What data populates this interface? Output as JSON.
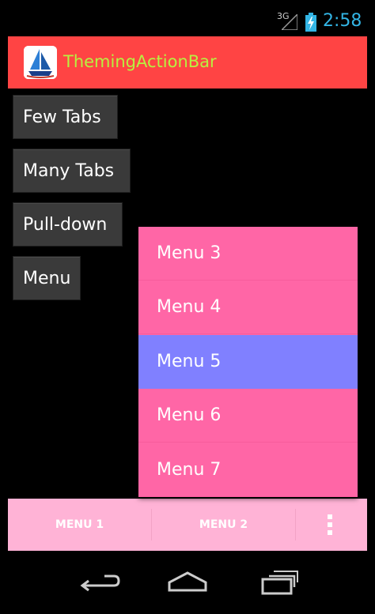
{
  "status_bar": {
    "network_type": "3G",
    "time": "2:58",
    "icons": [
      "signal-icon",
      "battery-charging-icon"
    ]
  },
  "action_bar": {
    "title": "ThemingActionBar",
    "icon": "sailboat-icon",
    "colors": {
      "background": "#ff4444",
      "title": "#b8f040"
    }
  },
  "buttons": [
    {
      "label": "Few Tabs"
    },
    {
      "label": "Many Tabs"
    },
    {
      "label": "Pull-down"
    },
    {
      "label": "Menu"
    }
  ],
  "popup_menu": {
    "items": [
      {
        "label": "Menu 3",
        "selected": false
      },
      {
        "label": "Menu 4",
        "selected": false
      },
      {
        "label": "Menu 5",
        "selected": true
      },
      {
        "label": "Menu 6",
        "selected": false
      },
      {
        "label": "Menu 7",
        "selected": false
      }
    ],
    "colors": {
      "background": "#ff66a6",
      "selected": "#8080ff"
    }
  },
  "split_action_bar": {
    "items": [
      {
        "label": "MENU 1"
      },
      {
        "label": "MENU 2"
      }
    ],
    "overflow_icon": "overflow-menu-icon",
    "colors": {
      "background": "#ffb3d6"
    }
  },
  "nav_bar": {
    "icons": [
      "back-icon",
      "home-icon",
      "recent-apps-icon"
    ]
  }
}
